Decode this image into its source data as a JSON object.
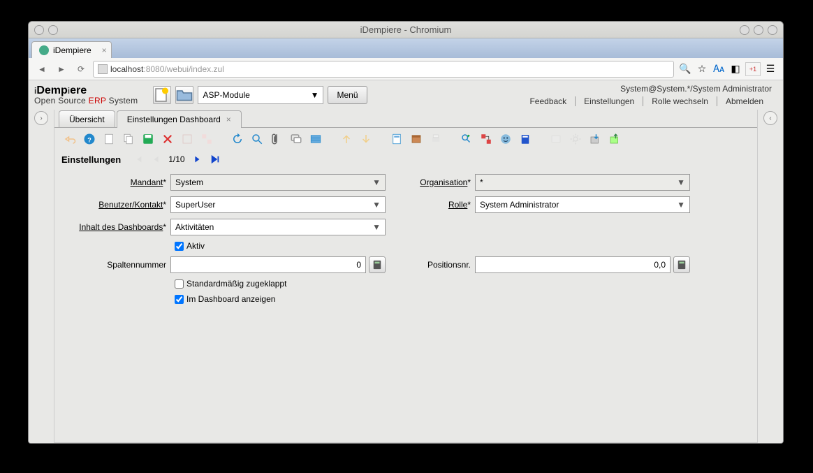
{
  "window": {
    "title": "iDempiere - Chromium"
  },
  "browser": {
    "tab": "iDempiere",
    "url_host": "localhost",
    "url_port": ":8080",
    "url_path": "/webui/index.zul"
  },
  "app": {
    "logo_main": "iDempiere",
    "logo_sub_pre": "Open Source ",
    "logo_sub_red": "ERP",
    "logo_sub_post": " System",
    "header_select": "ASP-Module",
    "menu_button": "Menü",
    "user_info": "System@System.*/System Administrator",
    "links": {
      "feedback": "Feedback",
      "preferences": "Einstellungen",
      "change_role": "Rolle wechseln",
      "logout": "Abmelden"
    }
  },
  "tabs": {
    "overview": "Übersicht",
    "settings_dashboard": "Einstellungen Dashboard"
  },
  "pager": {
    "title": "Einstellungen",
    "position": "1/10"
  },
  "form": {
    "mandant_label": "Mandant",
    "mandant_value": "System",
    "organisation_label": "Organisation",
    "organisation_value": "*",
    "user_label": "Benutzer/Kontakt",
    "user_value": "SuperUser",
    "role_label": "Rolle",
    "role_value": "System Administrator",
    "content_label": "Inhalt des Dashboards",
    "content_value": "Aktivitäten",
    "active_label": "Aktiv",
    "column_label": "Spaltennummer",
    "column_value": "0",
    "position_label": "Positionsnr.",
    "position_value": "0,0",
    "collapsed_label": "Standardmäßig zugeklappt",
    "show_label": "Im Dashboard anzeigen"
  }
}
